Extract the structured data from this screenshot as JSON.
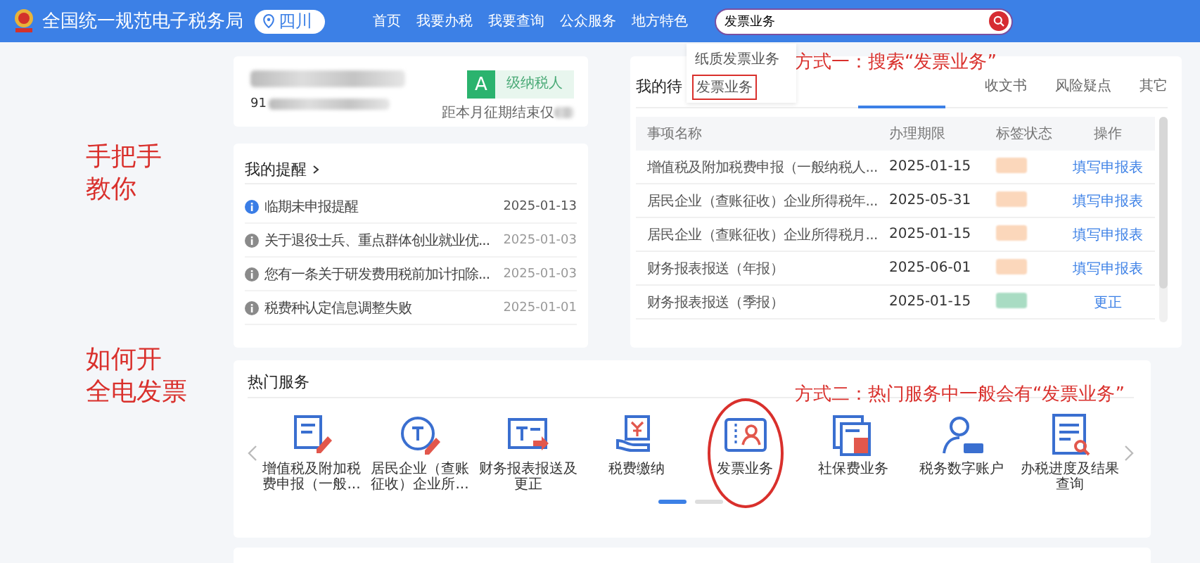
{
  "header": {
    "title": "全国统一规范电子税务局",
    "region": "四川",
    "nav": [
      "首页",
      "我要办税",
      "我要查询",
      "公众服务",
      "地方特色"
    ],
    "search": {
      "value": "发票业务"
    },
    "suggestions": [
      {
        "label": "纸质发票业务",
        "highlighted": false
      },
      {
        "label": "发票业务",
        "highlighted": true
      }
    ]
  },
  "annotations": [
    {
      "kind": "side",
      "lines": [
        "手把手",
        "教你"
      ]
    },
    {
      "kind": "side",
      "lines": [
        "如何开",
        "全电发票"
      ]
    },
    {
      "kind": "search",
      "text": "方式一：搜索“发票业务”"
    },
    {
      "kind": "hot",
      "text": "方式二：热门服务中一般会有“发票业务”"
    }
  ],
  "company": {
    "id_prefix": "91",
    "grade": "A",
    "grade_label": "级纳税人",
    "deadline": "距本月征期结束仅"
  },
  "reminders": {
    "title": "我的提醒",
    "items": [
      {
        "text": "临期未申报提醒",
        "date": "2025-01-13",
        "unread": true
      },
      {
        "text": "关于退役士兵、重点群体创业就业优...",
        "date": "2025-01-03",
        "unread": false
      },
      {
        "text": "您有一条关于研发费用税前加计扣除...",
        "date": "2025-01-03",
        "unread": false
      },
      {
        "text": "税费种认定信息调整失败",
        "date": "2025-01-01",
        "unread": false
      }
    ]
  },
  "todo": {
    "title": "我的待",
    "tabs": [
      {
        "label": "收文书",
        "selected": false
      },
      {
        "label": "风险疑点",
        "selected": false
      },
      {
        "label": "其它",
        "selected": false
      }
    ],
    "columns": [
      "事项名称",
      "办理期限",
      "标签状态",
      "操作"
    ],
    "rows": [
      {
        "name": "增值税及附加税费申报（一般纳税人...",
        "date": "2025-01-15",
        "color": "#fbd7bb",
        "action": "填写申报表"
      },
      {
        "name": "居民企业（查账征收）企业所得税年...",
        "date": "2025-05-31",
        "color": "#fbd7bb",
        "action": "填写申报表"
      },
      {
        "name": "居民企业（查账征收）企业所得税月...",
        "date": "2025-01-15",
        "color": "#fbd7bb",
        "action": "填写申报表"
      },
      {
        "name": "财务报表报送（年报）",
        "date": "2025-06-01",
        "color": "#fbd7bb",
        "action": "填写申报表"
      },
      {
        "name": "财务报表报送（季报）",
        "date": "2025-01-15",
        "color": "#a9dcc3",
        "action": "更正"
      }
    ]
  },
  "hot": {
    "title": "热门服务",
    "items": [
      {
        "label": "增值税及附加税费申报（一般...",
        "circled": false
      },
      {
        "label": "居民企业（查账征收）企业所...",
        "circled": false
      },
      {
        "label": "财务报表报送及更正",
        "circled": false
      },
      {
        "label": "税费缴纳",
        "circled": false
      },
      {
        "label": "发票业务",
        "circled": true
      },
      {
        "label": "社保费业务",
        "circled": false
      },
      {
        "label": "税务数字账户",
        "circled": false
      },
      {
        "label": "办税进度及结果查询",
        "circled": false
      }
    ],
    "pages": [
      {
        "selected": true
      },
      {
        "selected": false
      }
    ]
  }
}
